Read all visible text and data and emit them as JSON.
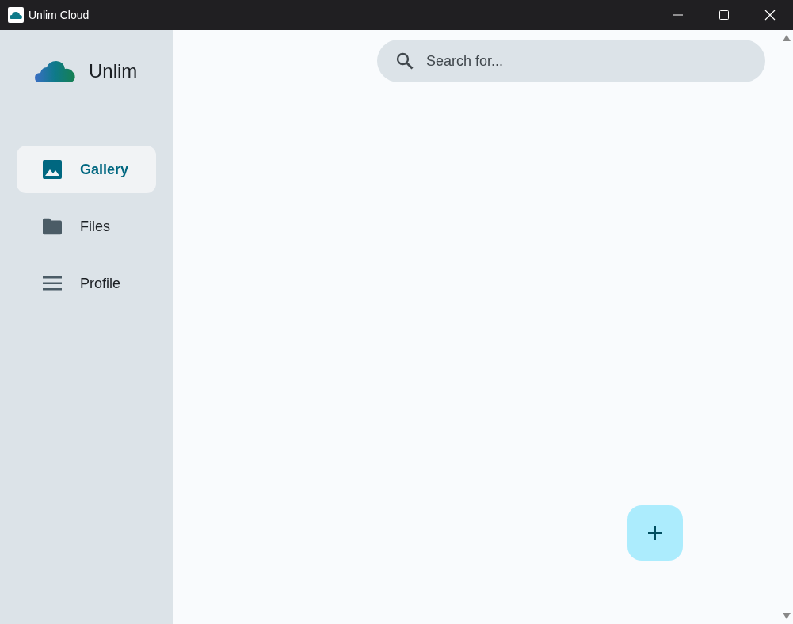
{
  "window": {
    "title": "Unlim Cloud"
  },
  "sidebar": {
    "brand": "Unlim",
    "items": [
      {
        "label": "Gallery",
        "kind": "image",
        "selected": true
      },
      {
        "label": "Files",
        "kind": "folder",
        "selected": false
      },
      {
        "label": "Profile",
        "kind": "menu",
        "selected": false
      }
    ]
  },
  "search": {
    "placeholder": "Search for..."
  }
}
